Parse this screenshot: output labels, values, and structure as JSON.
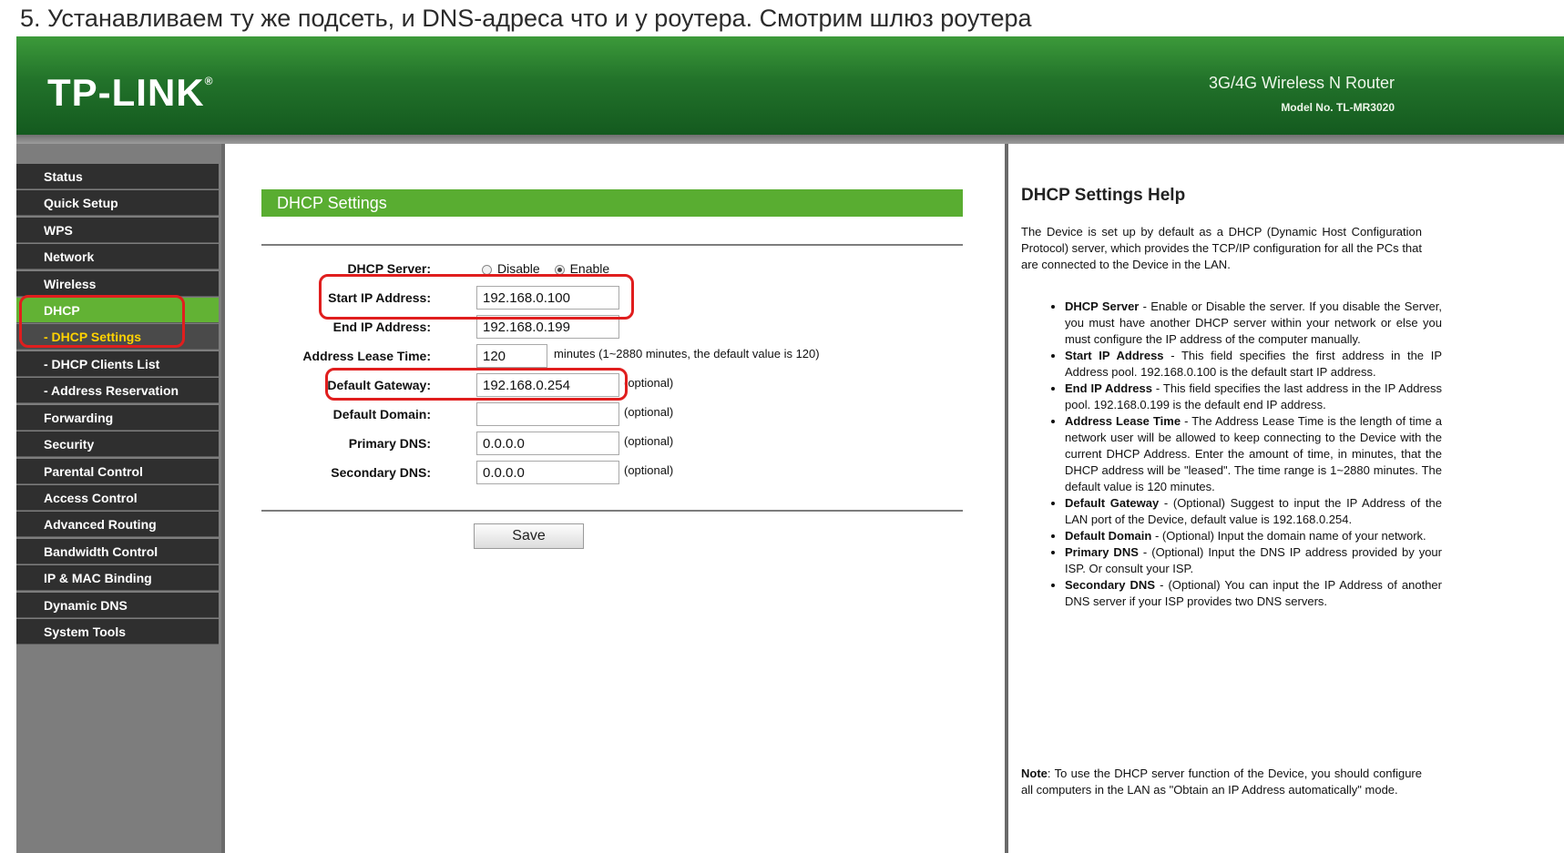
{
  "caption": "5. Устанавливаем ту же подсеть, и DNS-адреса что и у роутера. Смотрим шлюз роутера",
  "header": {
    "logo": "TP-LINK",
    "logo_mark": "®",
    "product": "3G/4G Wireless N Router",
    "model": "Model No. TL-MR3020"
  },
  "sidebar": {
    "items": [
      {
        "label": "Status"
      },
      {
        "label": "Quick Setup"
      },
      {
        "label": "WPS"
      },
      {
        "label": "Network"
      },
      {
        "label": "Wireless"
      },
      {
        "label": "DHCP"
      },
      {
        "label": "- DHCP Settings"
      },
      {
        "label": "- DHCP Clients List"
      },
      {
        "label": "- Address Reservation"
      },
      {
        "label": "Forwarding"
      },
      {
        "label": "Security"
      },
      {
        "label": "Parental Control"
      },
      {
        "label": "Access Control"
      },
      {
        "label": "Advanced Routing"
      },
      {
        "label": "Bandwidth Control"
      },
      {
        "label": "IP & MAC Binding"
      },
      {
        "label": "Dynamic DNS"
      },
      {
        "label": "System Tools"
      }
    ]
  },
  "form": {
    "title": "DHCP Settings",
    "dhcp_server_label": "DHCP Server:",
    "disable_label": "Disable",
    "enable_label": "Enable",
    "selected": "Enable",
    "start_ip_label": "Start IP Address:",
    "start_ip": "192.168.0.100",
    "end_ip_label": "End IP Address:",
    "end_ip": "192.168.0.199",
    "lease_label": "Address Lease Time:",
    "lease": "120",
    "lease_note": "minutes (1~2880 minutes, the default value is 120)",
    "gateway_label": "Default Gateway:",
    "gateway": "192.168.0.254",
    "domain_label": "Default Domain:",
    "domain": "",
    "primary_dns_label": "Primary DNS:",
    "primary_dns": "0.0.0.0",
    "secondary_dns_label": "Secondary DNS:",
    "secondary_dns": "0.0.0.0",
    "optional": "(optional)",
    "save_label": "Save"
  },
  "help": {
    "title": "DHCP Settings Help",
    "intro": "The Device is set up by default as a DHCP (Dynamic Host Configuration Protocol) server, which provides the TCP/IP configuration for all the PCs that are connected to the Device in the LAN.",
    "items": [
      {
        "term": "DHCP Server",
        "text": " - Enable or Disable the server. If you disable the Server, you must have another DHCP server within your network or else you must configure the IP address of the computer manually."
      },
      {
        "term": "Start IP Address",
        "text": " - This field specifies the first address in the IP Address pool. 192.168.0.100 is the default start IP address."
      },
      {
        "term": "End IP Address",
        "text": " - This field specifies the last address in the IP Address pool. 192.168.0.199 is the default end IP address."
      },
      {
        "term": "Address Lease Time",
        "text": " - The Address Lease Time is the length of time a network user will be allowed to keep connecting to the Device with the current DHCP Address. Enter the amount of time, in minutes, that the DHCP address will be \"leased\". The time range is 1~2880 minutes. The default value is 120 minutes."
      },
      {
        "term": "Default Gateway",
        "text": " - (Optional) Suggest to input the IP Address of the LAN port of the Device, default value is 192.168.0.254."
      },
      {
        "term": "Default Domain",
        "text": " - (Optional) Input the domain name of your network."
      },
      {
        "term": "Primary DNS",
        "text": " - (Optional) Input the DNS IP address provided by your ISP. Or consult your ISP."
      },
      {
        "term": "Secondary DNS",
        "text": " - (Optional) You can input the IP Address of another DNS server if your ISP provides two DNS servers."
      }
    ],
    "note_term": "Note",
    "note": ": To use the DHCP server function of the Device, you should configure all computers in the LAN as \"Obtain an IP Address automatically\" mode."
  },
  "colors": {
    "brand_green": "#22722a",
    "title_green": "#59ad31",
    "highlight_red": "#e01e1e",
    "submenu_yellow": "#ffd200"
  }
}
